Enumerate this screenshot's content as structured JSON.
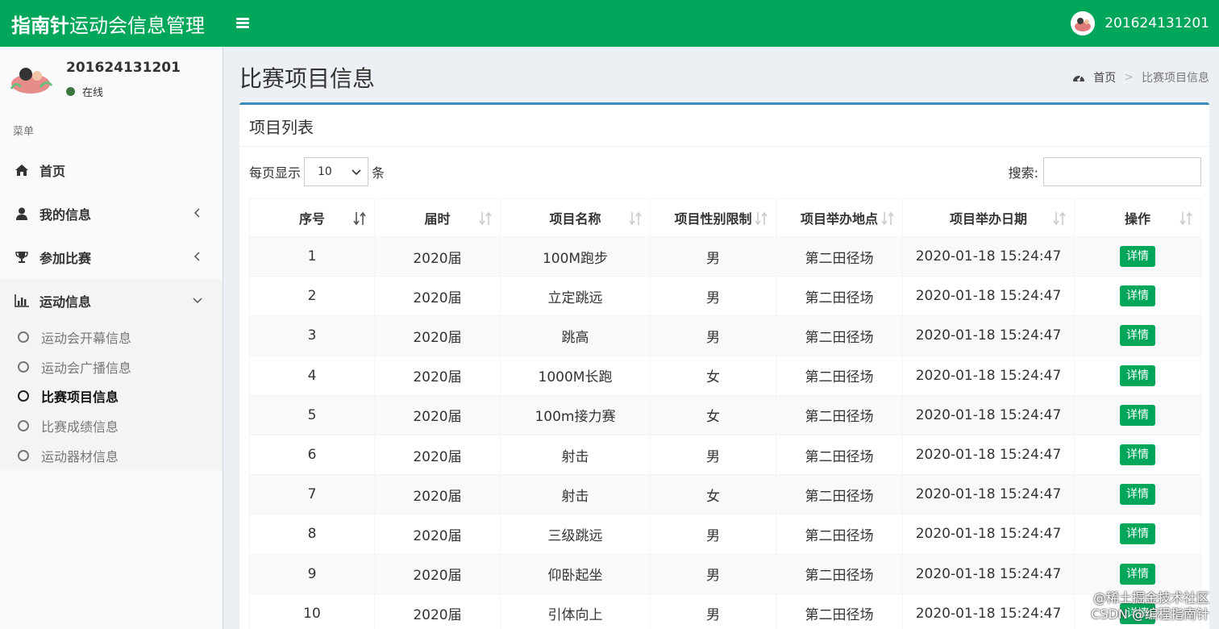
{
  "header": {
    "brand_bold": "指南针",
    "brand_rest": "运动会信息管理",
    "username": "201624131201"
  },
  "sidebar": {
    "user": {
      "name": "201624131201",
      "status": "在线"
    },
    "menu_header": "菜单",
    "items": [
      {
        "label": "首页",
        "icon": "home-icon"
      },
      {
        "label": "我的信息",
        "icon": "user-icon"
      },
      {
        "label": "参加比赛",
        "icon": "trophy-icon"
      },
      {
        "label": "运动信息",
        "icon": "bar-chart-icon"
      }
    ],
    "submenu": [
      {
        "label": "运动会开幕信息"
      },
      {
        "label": "运动会广播信息"
      },
      {
        "label": "比赛项目信息"
      },
      {
        "label": "比赛成绩信息"
      },
      {
        "label": "运动器材信息"
      }
    ]
  },
  "page": {
    "title": "比赛项目信息",
    "breadcrumb_home": "首页",
    "breadcrumb_current": "比赛项目信息"
  },
  "box": {
    "title": "项目列表",
    "length_prefix": "每页显示",
    "length_value": "10",
    "length_suffix": "条",
    "search_label": "搜索:"
  },
  "table": {
    "columns": [
      "序号",
      "届时",
      "项目名称",
      "项目性别限制",
      "项目举办地点",
      "项目举办日期",
      "操作"
    ],
    "rows": [
      [
        "1",
        "2020届",
        "100M跑步",
        "男",
        "第二田径场",
        "2020-01-18 15:24:47",
        "详情"
      ],
      [
        "2",
        "2020届",
        "立定跳远",
        "男",
        "第二田径场",
        "2020-01-18 15:24:47",
        "详情"
      ],
      [
        "3",
        "2020届",
        "跳高",
        "男",
        "第二田径场",
        "2020-01-18 15:24:47",
        "详情"
      ],
      [
        "4",
        "2020届",
        "1000M长跑",
        "女",
        "第二田径场",
        "2020-01-18 15:24:47",
        "详情"
      ],
      [
        "5",
        "2020届",
        "100m接力赛",
        "女",
        "第二田径场",
        "2020-01-18 15:24:47",
        "详情"
      ],
      [
        "6",
        "2020届",
        "射击",
        "男",
        "第二田径场",
        "2020-01-18 15:24:47",
        "详情"
      ],
      [
        "7",
        "2020届",
        "射击",
        "女",
        "第二田径场",
        "2020-01-18 15:24:47",
        "详情"
      ],
      [
        "8",
        "2020届",
        "三级跳远",
        "男",
        "第二田径场",
        "2020-01-18 15:24:47",
        "详情"
      ],
      [
        "9",
        "2020届",
        "仰卧起坐",
        "男",
        "第二田径场",
        "2020-01-18 15:24:47",
        "详情"
      ],
      [
        "10",
        "2020届",
        "引体向上",
        "男",
        "第二田径场",
        "2020-01-18 15:24:47",
        "详情"
      ]
    ]
  },
  "watermark": {
    "line1": "@稀土掘金技术社区",
    "line2": "CSDN @编程指南针"
  },
  "colors": {
    "header_green": "#00a65a",
    "box_border_blue": "#3c8dbc",
    "detail_button": "#00a65a"
  }
}
